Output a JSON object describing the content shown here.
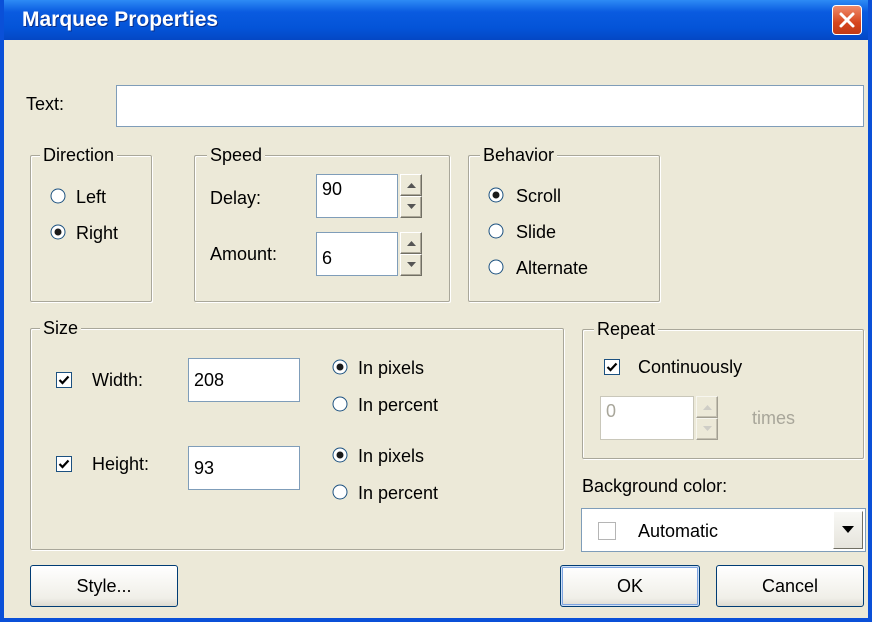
{
  "window": {
    "title": "Marquee Properties"
  },
  "text_field": {
    "label": "Text:",
    "value": ""
  },
  "direction": {
    "legend": "Direction",
    "options": [
      {
        "label": "Left",
        "selected": false
      },
      {
        "label": "Right",
        "selected": true
      }
    ]
  },
  "speed": {
    "legend": "Speed",
    "delay": {
      "label": "Delay:",
      "value": "90"
    },
    "amount": {
      "label": "Amount:",
      "value": "6"
    }
  },
  "behavior": {
    "legend": "Behavior",
    "options": [
      {
        "label": "Scroll",
        "selected": true
      },
      {
        "label": "Slide",
        "selected": false
      },
      {
        "label": "Alternate",
        "selected": false
      }
    ]
  },
  "size": {
    "legend": "Size",
    "width": {
      "label": "Width:",
      "checked": true,
      "value": "208",
      "unit_pixels": "In pixels",
      "unit_percent": "In percent",
      "pixels_selected": true
    },
    "height": {
      "label": "Height:",
      "checked": true,
      "value": "93",
      "unit_pixels": "In pixels",
      "unit_percent": "In percent",
      "pixels_selected": true
    }
  },
  "repeat": {
    "legend": "Repeat",
    "continuously": {
      "label": "Continuously",
      "checked": true
    },
    "times": {
      "value": "0",
      "label": "times"
    }
  },
  "background_color": {
    "label": "Background color:",
    "selected": "Automatic"
  },
  "buttons": {
    "style": "Style...",
    "ok": "OK",
    "cancel": "Cancel"
  }
}
